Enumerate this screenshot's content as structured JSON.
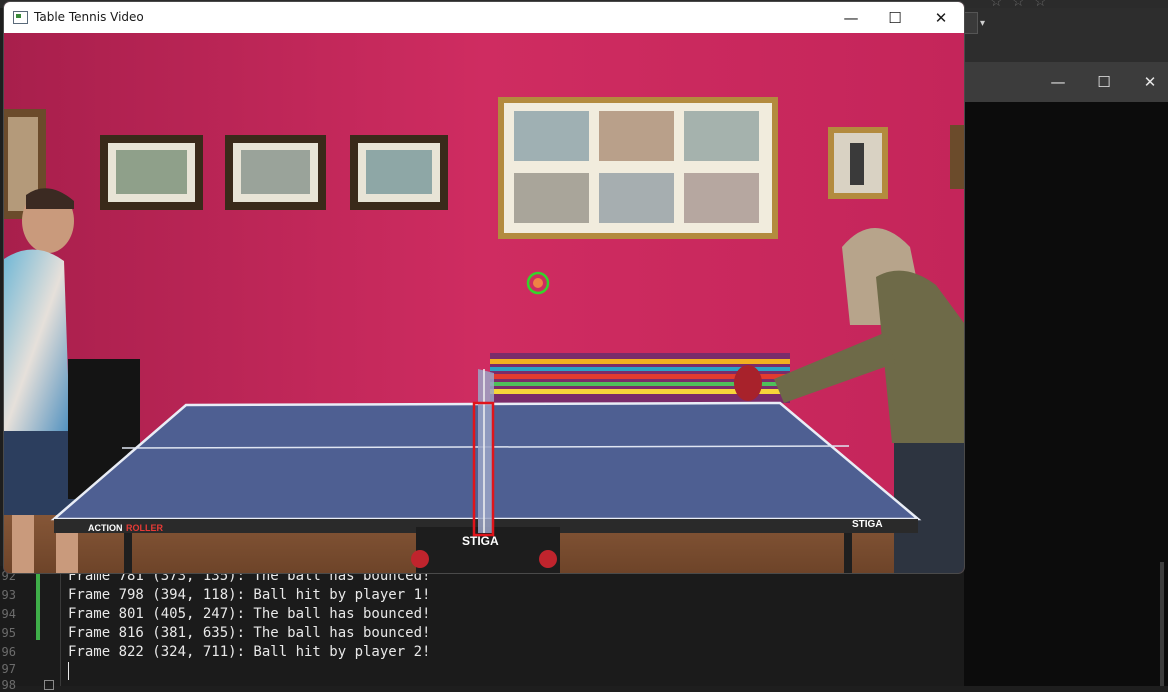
{
  "window": {
    "title": "Table Tennis Video",
    "minimize_label": "—",
    "maximize_label": "☐",
    "close_label": "✕"
  },
  "background_window": {
    "minimize_label": "—",
    "maximize_label": "☐",
    "close_label": "✕",
    "dropdown_arrow": "▾"
  },
  "terminal": {
    "line_numbers": [
      "92",
      "93",
      "94",
      "95",
      "96",
      "97",
      "98"
    ],
    "lines": [
      "Frame 781 (373, 135): The ball has bounced!",
      "Frame 798 (394, 118): Ball hit by player 1!",
      "Frame 801 (405, 247): The ball has bounced!",
      "Frame 816 (381, 635): The ball has bounced!",
      "Frame 822 (324, 711): Ball hit by player 2!"
    ]
  },
  "table_brand": {
    "left_label": "ACTION",
    "left_label_accent": "ROLLER",
    "right_label": "STIGA",
    "net_post_label": "STIGA"
  },
  "colors": {
    "wall": "#c9265a",
    "table": "#4e5f92",
    "net_box": "#e0141a",
    "ball_marker": "#36d32b",
    "ball": "#f08244"
  }
}
